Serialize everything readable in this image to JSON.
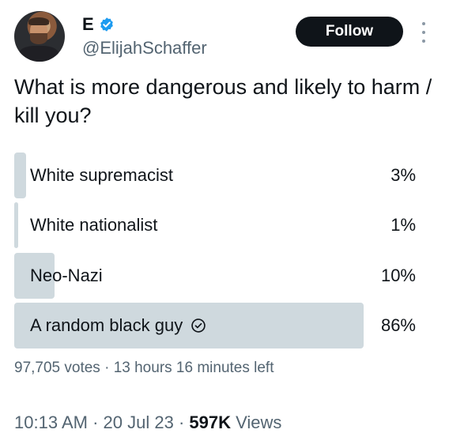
{
  "author": {
    "display_name": "E",
    "handle": "@ElijahSchaffer"
  },
  "follow_label": "Follow",
  "question": "What is more dangerous and likely to harm / kill you?",
  "poll": {
    "options": [
      {
        "label": "White supremacist",
        "percent_text": "3%",
        "percent": 3
      },
      {
        "label": "White nationalist",
        "percent_text": "1%",
        "percent": 1
      },
      {
        "label": "Neo-Nazi",
        "percent_text": "10%",
        "percent": 10
      },
      {
        "label": "A random black guy",
        "percent_text": "86%",
        "percent": 86
      }
    ],
    "votes": "97,705 votes",
    "separator": "·",
    "time_left": "13 hours 16 minutes left"
  },
  "footer": {
    "time": "10:13 AM",
    "dot": "·",
    "date": "20 Jul 23",
    "views_count": "597K",
    "views_label": "Views"
  },
  "colors": {
    "verified": "#1d9bf0",
    "bar": "#cfd9de",
    "follow_bg": "#0f1419"
  }
}
